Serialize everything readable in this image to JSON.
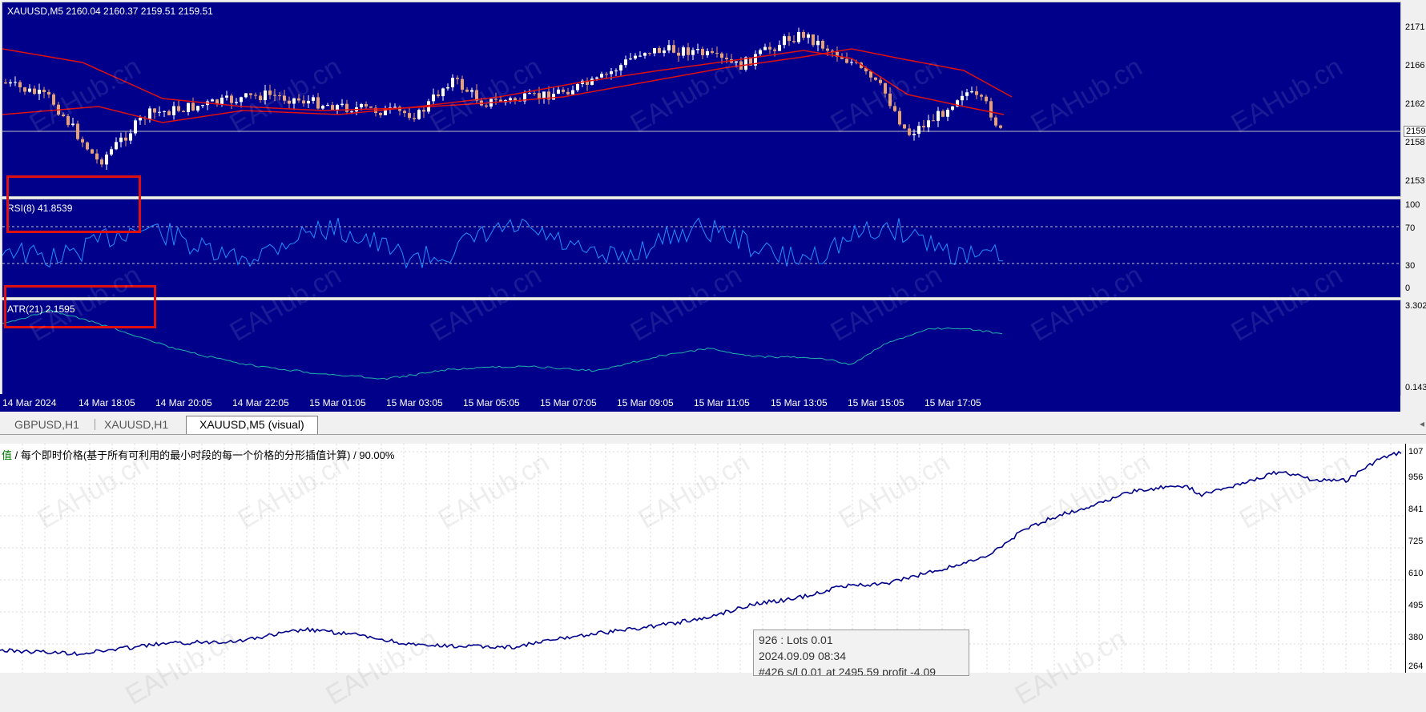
{
  "price_pane": {
    "label": "XAUUSD,M5  2160.04 2160.37 2159.51 2159.51",
    "scale": [
      "2171",
      "2166",
      "2162",
      "2158",
      "2153"
    ],
    "current_price": "2159"
  },
  "rsi_pane": {
    "label": "RSI(8) 41.8539",
    "scale": [
      "100",
      "70",
      "30",
      "0"
    ]
  },
  "atr_pane": {
    "label": "ATR(21) 2.1595",
    "scale": [
      "3.302",
      "0.143"
    ]
  },
  "time_axis": [
    "14 Mar 2024",
    "14 Mar 18:05",
    "14 Mar 20:05",
    "14 Mar 22:05",
    "15 Mar 01:05",
    "15 Mar 03:05",
    "15 Mar 05:05",
    "15 Mar 07:05",
    "15 Mar 09:05",
    "15 Mar 11:05",
    "15 Mar 13:05",
    "15 Mar 15:05",
    "15 Mar 17:05"
  ],
  "tabs": [
    {
      "label": "GBPUSD,H1"
    },
    {
      "label": "XAUUSD,H1"
    },
    {
      "label": "XAUUSD,M5 (visual)"
    }
  ],
  "graph": {
    "title_lead": "值",
    "title": " / 每个即时价格(基于所有可利用的最小时段的每一个价格的分形插值计算) / 90.00%",
    "scale": [
      "107",
      "956",
      "841",
      "725",
      "610",
      "495",
      "380",
      "264"
    ]
  },
  "tooltip": {
    "line1": "926 : Lots 0.01",
    "line2": "2024.09.09 08:34",
    "line3": "#426 s/l 0.01 at 2495.59 profit -4.09"
  },
  "watermark": "EAHub.cn",
  "colors": {
    "chart_bg": "#00008b",
    "ma_line": "#e01010",
    "rsi_line": "#1e90ff",
    "atr_line": "#20b2aa",
    "balance_line": "#00008b",
    "highlight_box": "#e01010"
  }
}
